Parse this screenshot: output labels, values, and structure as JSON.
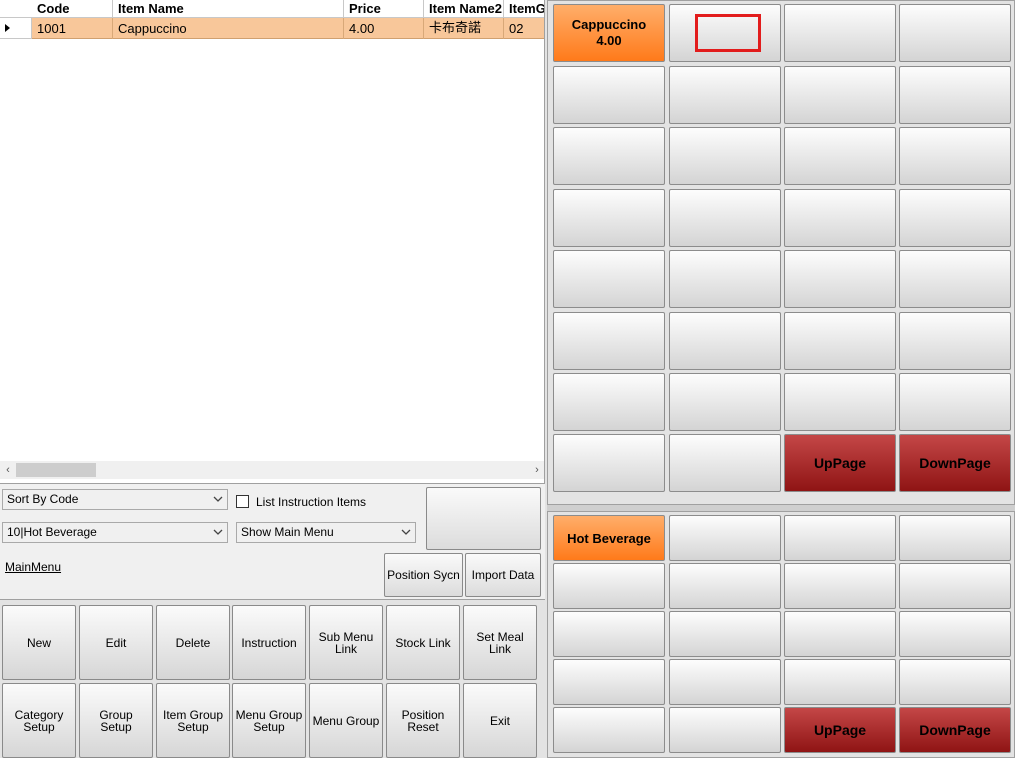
{
  "grid": {
    "columns": [
      "Code",
      "Item Name",
      "Price",
      "Item Name2",
      "ItemG"
    ],
    "rows": [
      {
        "code": "1001",
        "item_name": "Cappuccino",
        "price": "4.00",
        "item_name2": "卡布奇諾",
        "item_group": "02"
      }
    ]
  },
  "controls": {
    "sort_select": "Sort By Code",
    "group_select": "10|Hot Beverage",
    "menu_select": "Show Main Menu",
    "list_instruction_label": "List Instruction Items",
    "main_menu_link": "MainMenu",
    "position_sync_label": "Position Sycn",
    "import_data_label": "Import Data"
  },
  "actions": {
    "row1": [
      "New",
      "Edit",
      "Delete",
      "Instruction",
      "Sub Menu Link",
      "Stock Link",
      "Set Meal Link"
    ],
    "row2": [
      "Category Setup",
      "Group Setup",
      "Item Group Setup",
      "Menu Group Setup",
      "Menu Group",
      "Position Reset",
      "Exit"
    ]
  },
  "items_panel": {
    "selected_item_name": "Cappuccino",
    "selected_item_price": "4.00",
    "uppage_label": "UpPage",
    "downpage_label": "DownPage"
  },
  "groups_panel": {
    "selected_group": "Hot Beverage",
    "uppage_label": "UpPage",
    "downpage_label": "DownPage"
  },
  "colors": {
    "selected_row": "#f8c79a",
    "orange_tile": "#ff8c2a",
    "red_tile": "#a52020",
    "highlight_box": "#e21c1c"
  }
}
